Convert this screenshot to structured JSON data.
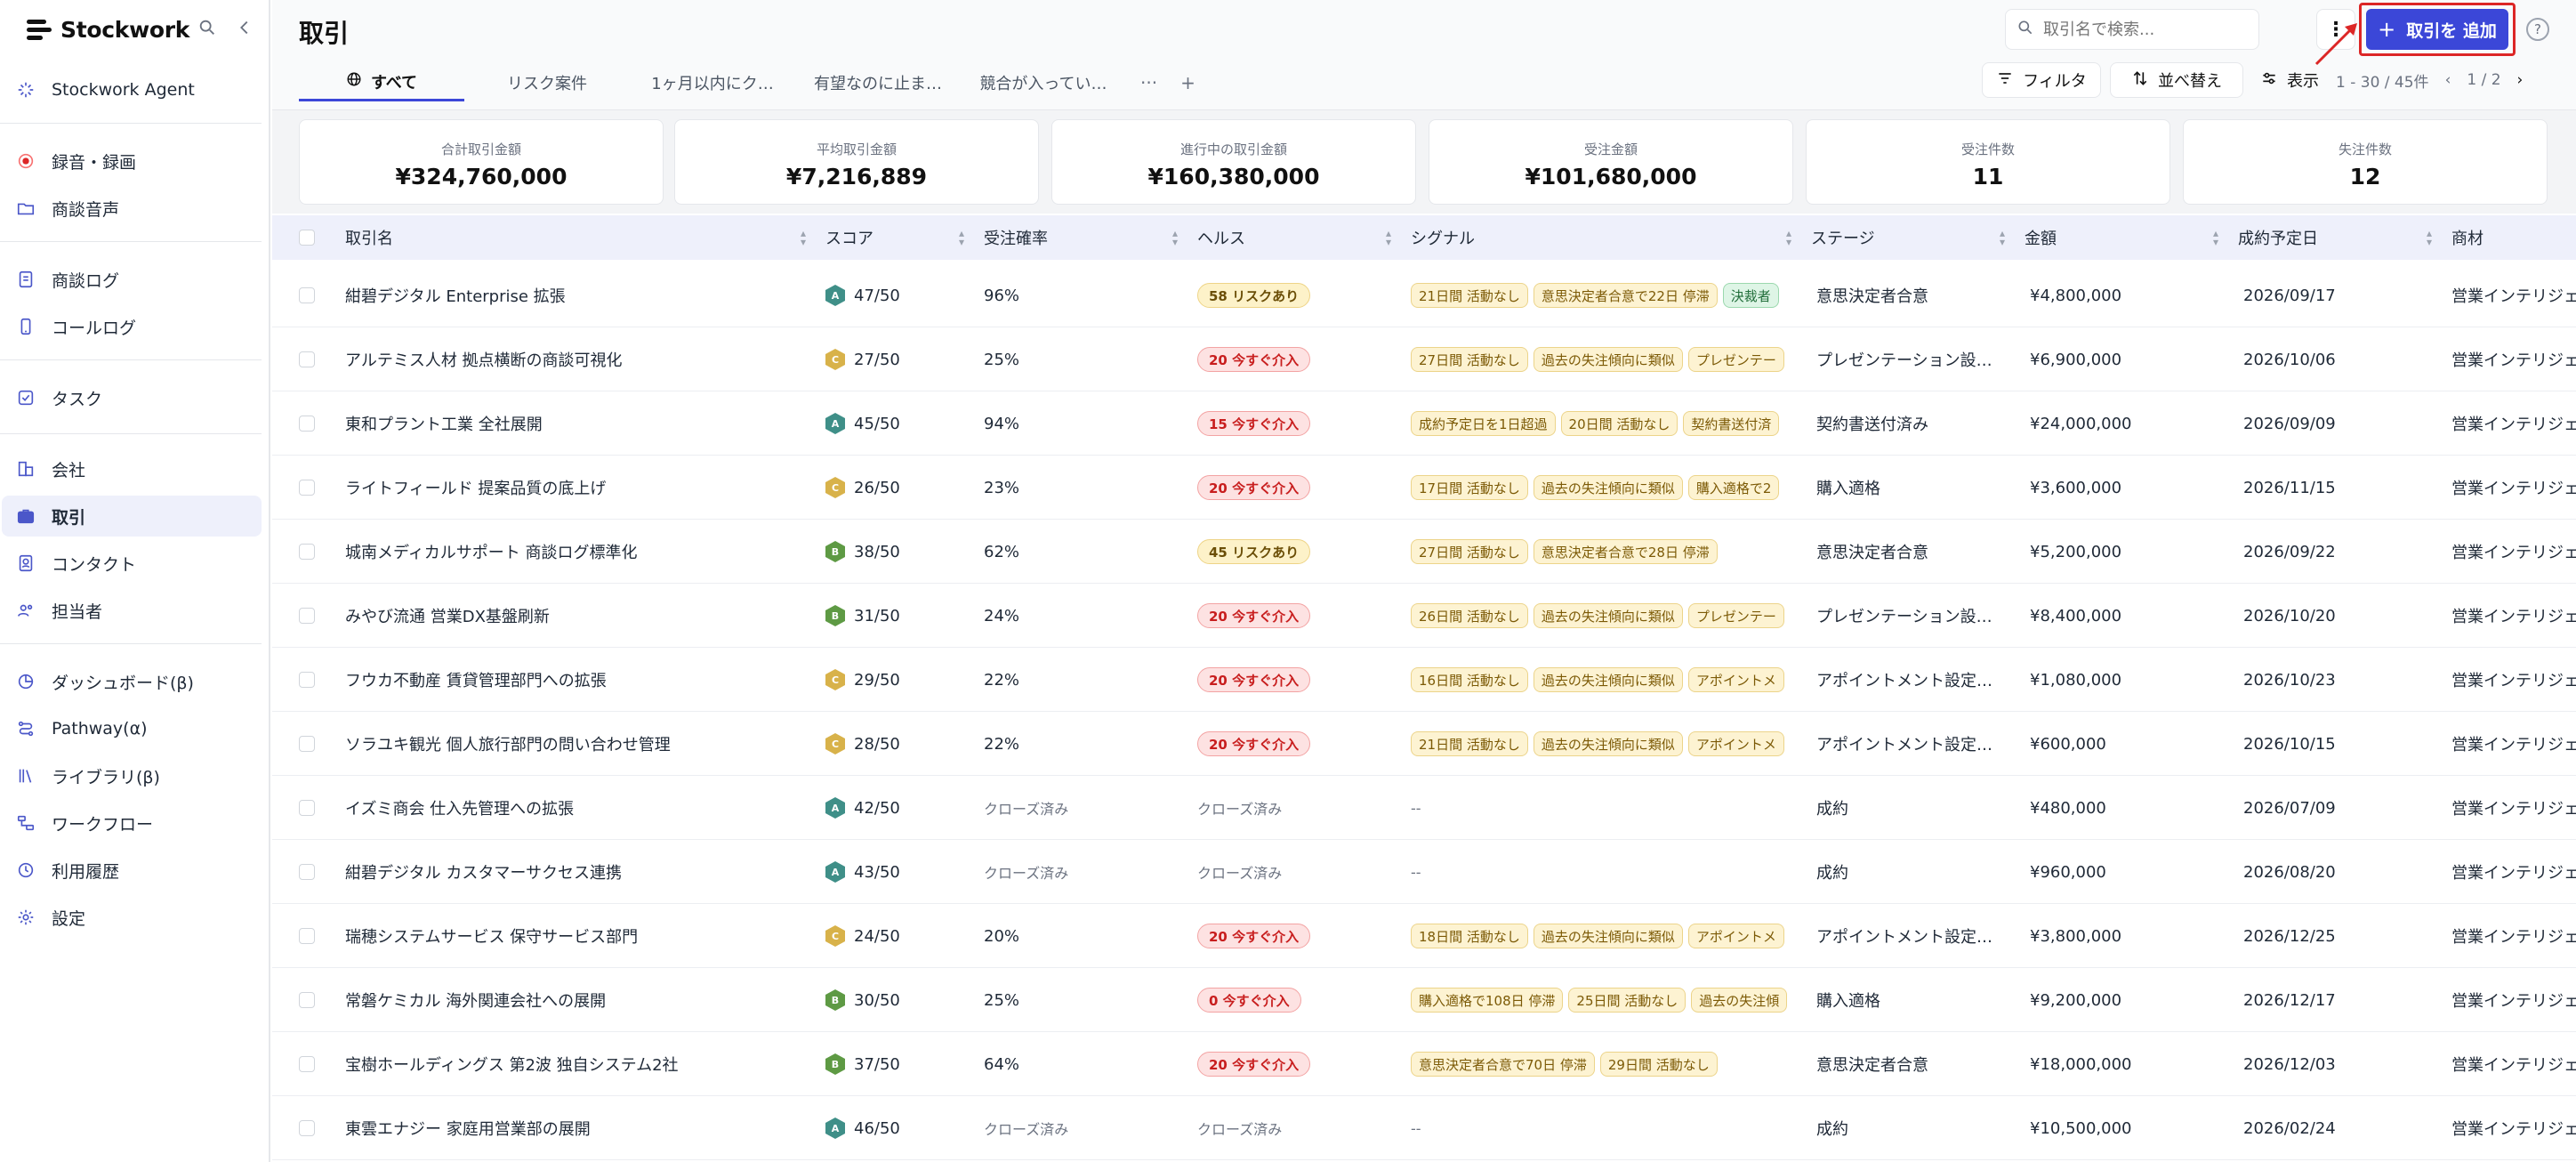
{
  "brand": {
    "name": "Stockwork"
  },
  "sidebar": {
    "items": [
      {
        "label": "Stockwork Agent",
        "icon": "agent-icon"
      },
      {
        "label": "録音・録画",
        "icon": "record-icon"
      },
      {
        "label": "商談音声",
        "icon": "folder-icon"
      },
      {
        "label": "商談ログ",
        "icon": "document-icon"
      },
      {
        "label": "コールログ",
        "icon": "phone-icon"
      },
      {
        "label": "タスク",
        "icon": "checkbox-icon"
      },
      {
        "label": "会社",
        "icon": "building-icon"
      },
      {
        "label": "取引",
        "icon": "briefcase-icon"
      },
      {
        "label": "コンタクト",
        "icon": "contact-icon"
      },
      {
        "label": "担当者",
        "icon": "users-icon"
      },
      {
        "label": "ダッシュボード(β)",
        "icon": "dashboard-icon"
      },
      {
        "label": "Pathway(α)",
        "icon": "pathway-icon"
      },
      {
        "label": "ライブラリ(β)",
        "icon": "library-icon"
      },
      {
        "label": "ワークフロー",
        "icon": "workflow-icon"
      },
      {
        "label": "利用履歴",
        "icon": "history-icon"
      },
      {
        "label": "設定",
        "icon": "gear-icon"
      }
    ]
  },
  "header": {
    "title": "取引",
    "search_placeholder": "取引名で検索...",
    "add_label": "取引を 追加",
    "more_label": "⋮",
    "help_label": "?"
  },
  "tabs": [
    {
      "label": "すべて",
      "active": true
    },
    {
      "label": "リスク案件",
      "active": false
    },
    {
      "label": "1ヶ月以内にク…",
      "active": false
    },
    {
      "label": "有望なのに止ま…",
      "active": false
    },
    {
      "label": "競合が入ってい…",
      "active": false
    }
  ],
  "tab_extras": {
    "more": "···",
    "add": "+"
  },
  "toolbar": {
    "filter_label": "フィルタ",
    "sort_label": "並べ替え",
    "view_label": "表示",
    "range_text": "1 - 30 / 45件",
    "page_text": "1 / 2"
  },
  "summary": [
    {
      "label": "合計取引金額",
      "value": "¥324,760,000"
    },
    {
      "label": "平均取引金額",
      "value": "¥7,216,889"
    },
    {
      "label": "進行中の取引金額",
      "value": "¥160,380,000"
    },
    {
      "label": "受注金額",
      "value": "¥101,680,000"
    },
    {
      "label": "受注件数",
      "value": "11"
    },
    {
      "label": "失注件数",
      "value": "12"
    }
  ],
  "table": {
    "columns": [
      "取引名",
      "スコア",
      "受注確率",
      "ヘルス",
      "シグナル",
      "ステージ",
      "金額",
      "成約予定日",
      "商材"
    ],
    "rows": [
      {
        "name": "紺碧デジタル Enterprise 拡張",
        "grade": "A",
        "score": "47/50",
        "prob": "96%",
        "health": "58 リスクあり",
        "health_type": "yellow",
        "signals": [
          {
            "t": "21日間 活動なし"
          },
          {
            "t": "意思決定者合意で22日 停滞"
          },
          {
            "t": "決裁者",
            "g": true
          }
        ],
        "stage": "意思決定者合意",
        "amount": "¥4,800,000",
        "date": "2026/09/17",
        "product": "営業インテリジェ"
      },
      {
        "name": "アルテミス人材 拠点横断の商談可視化",
        "grade": "C",
        "score": "27/50",
        "prob": "25%",
        "health": "20 今すぐ介入",
        "health_type": "red",
        "signals": [
          {
            "t": "27日間 活動なし"
          },
          {
            "t": "過去の失注傾向に類似"
          },
          {
            "t": "プレゼンテー"
          }
        ],
        "stage": "プレゼンテーション設…",
        "amount": "¥6,900,000",
        "date": "2026/10/06",
        "product": "営業インテリジェ"
      },
      {
        "name": "東和プラント工業 全社展開",
        "grade": "A",
        "score": "45/50",
        "prob": "94%",
        "health": "15 今すぐ介入",
        "health_type": "red",
        "signals": [
          {
            "t": "成約予定日を1日超過"
          },
          {
            "t": "20日間 活動なし"
          },
          {
            "t": "契約書送付済"
          }
        ],
        "stage": "契約書送付済み",
        "amount": "¥24,000,000",
        "date": "2026/09/09",
        "product": "営業インテリジェ"
      },
      {
        "name": "ライトフィールド 提案品質の底上げ",
        "grade": "C",
        "score": "26/50",
        "prob": "23%",
        "health": "20 今すぐ介入",
        "health_type": "red",
        "signals": [
          {
            "t": "17日間 活動なし"
          },
          {
            "t": "過去の失注傾向に類似"
          },
          {
            "t": "購入適格で2"
          }
        ],
        "stage": "購入適格",
        "amount": "¥3,600,000",
        "date": "2026/11/15",
        "product": "営業インテリジェ"
      },
      {
        "name": "城南メディカルサポート 商談ログ標準化",
        "grade": "B",
        "score": "38/50",
        "prob": "62%",
        "health": "45 リスクあり",
        "health_type": "yellow",
        "signals": [
          {
            "t": "27日間 活動なし"
          },
          {
            "t": "意思決定者合意で28日 停滞"
          }
        ],
        "stage": "意思決定者合意",
        "amount": "¥5,200,000",
        "date": "2026/09/22",
        "product": "営業インテリジェ"
      },
      {
        "name": "みやび流通 営業DX基盤刷新",
        "grade": "B",
        "score": "31/50",
        "prob": "24%",
        "health": "20 今すぐ介入",
        "health_type": "red",
        "signals": [
          {
            "t": "26日間 活動なし"
          },
          {
            "t": "過去の失注傾向に類似"
          },
          {
            "t": "プレゼンテー"
          }
        ],
        "stage": "プレゼンテーション設…",
        "amount": "¥8,400,000",
        "date": "2026/10/20",
        "product": "営業インテリジェ"
      },
      {
        "name": "フウカ不動産 賃貸管理部門への拡張",
        "grade": "C",
        "score": "29/50",
        "prob": "22%",
        "health": "20 今すぐ介入",
        "health_type": "red",
        "signals": [
          {
            "t": "16日間 活動なし"
          },
          {
            "t": "過去の失注傾向に類似"
          },
          {
            "t": "アポイントメ"
          }
        ],
        "stage": "アポイントメント設定…",
        "amount": "¥1,080,000",
        "date": "2026/10/23",
        "product": "営業インテリジェ"
      },
      {
        "name": "ソラユキ観光 個人旅行部門の問い合わせ管理",
        "grade": "C",
        "score": "28/50",
        "prob": "22%",
        "health": "20 今すぐ介入",
        "health_type": "red",
        "signals": [
          {
            "t": "21日間 活動なし"
          },
          {
            "t": "過去の失注傾向に類似"
          },
          {
            "t": "アポイントメ"
          }
        ],
        "stage": "アポイントメント設定…",
        "amount": "¥600,000",
        "date": "2026/10/15",
        "product": "営業インテリジェ"
      },
      {
        "name": "イズミ商会 仕入先管理への拡張",
        "grade": "A",
        "score": "42/50",
        "prob": "クローズ済み",
        "health": "クローズ済み",
        "health_type": "closed",
        "signals": [],
        "signal_empty": "--",
        "stage": "成約",
        "amount": "¥480,000",
        "date": "2026/07/09",
        "product": "営業インテリジェ"
      },
      {
        "name": "紺碧デジタル カスタマーサクセス連携",
        "grade": "A",
        "score": "43/50",
        "prob": "クローズ済み",
        "health": "クローズ済み",
        "health_type": "closed",
        "signals": [],
        "signal_empty": "--",
        "stage": "成約",
        "amount": "¥960,000",
        "date": "2026/08/20",
        "product": "営業インテリジェ"
      },
      {
        "name": "瑞穂システムサービス 保守サービス部門",
        "grade": "C",
        "score": "24/50",
        "prob": "20%",
        "health": "20 今すぐ介入",
        "health_type": "red",
        "signals": [
          {
            "t": "18日間 活動なし"
          },
          {
            "t": "過去の失注傾向に類似"
          },
          {
            "t": "アポイントメ"
          }
        ],
        "stage": "アポイントメント設定…",
        "amount": "¥3,800,000",
        "date": "2026/12/25",
        "product": "営業インテリジェ"
      },
      {
        "name": "常磐ケミカル 海外関連会社への展開",
        "grade": "B",
        "score": "30/50",
        "prob": "25%",
        "health": "0 今すぐ介入",
        "health_type": "red",
        "signals": [
          {
            "t": "購入適格で108日 停滞"
          },
          {
            "t": "25日間 活動なし"
          },
          {
            "t": "過去の失注傾"
          }
        ],
        "stage": "購入適格",
        "amount": "¥9,200,000",
        "date": "2026/12/17",
        "product": "営業インテリジェ"
      },
      {
        "name": "宝樹ホールディングス 第2波 独自システム2社",
        "grade": "B",
        "score": "37/50",
        "prob": "64%",
        "health": "20 今すぐ介入",
        "health_type": "red",
        "signals": [
          {
            "t": "意思決定者合意で70日 停滞"
          },
          {
            "t": "29日間 活動なし"
          }
        ],
        "stage": "意思決定者合意",
        "amount": "¥18,000,000",
        "date": "2026/12/03",
        "product": "営業インテリジェ"
      },
      {
        "name": "東雲エナジー 家庭用営業部の展開",
        "grade": "A",
        "score": "46/50",
        "prob": "クローズ済み",
        "health": "クローズ済み",
        "health_type": "closed",
        "signals": [],
        "signal_empty": "--",
        "stage": "成約",
        "amount": "¥10,500,000",
        "date": "2026/02/24",
        "product": "営業インテリジェ"
      }
    ]
  },
  "colors": {
    "accent": "#3b47d8",
    "highlight": "#dc2626",
    "active_bg": "#eef0fb"
  }
}
